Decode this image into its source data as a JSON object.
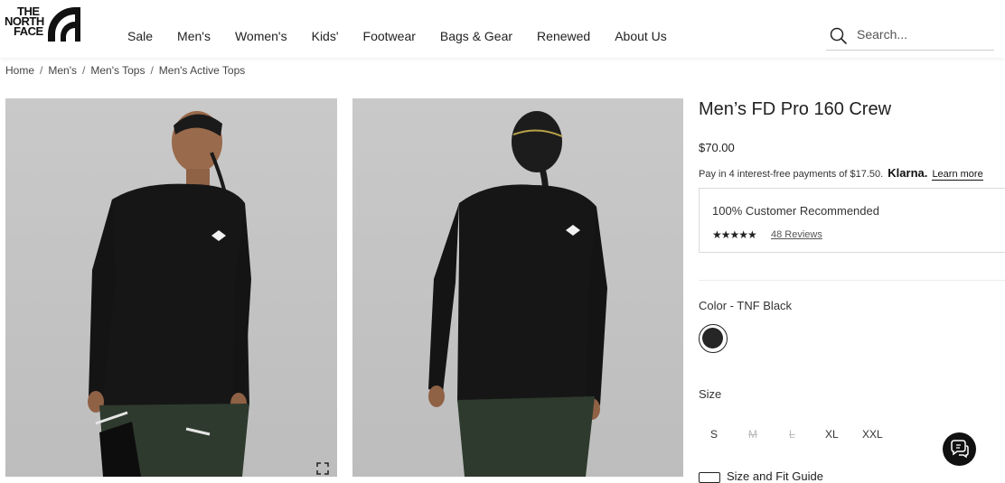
{
  "brand": {
    "logo_line1": "THE",
    "logo_line2": "NORTH",
    "logo_line3": "FACE"
  },
  "nav": {
    "items": [
      {
        "label": "Sale"
      },
      {
        "label": "Men's"
      },
      {
        "label": "Women's"
      },
      {
        "label": "Kids'"
      },
      {
        "label": "Footwear"
      },
      {
        "label": "Bags & Gear"
      },
      {
        "label": "Renewed"
      },
      {
        "label": "About Us"
      }
    ]
  },
  "search": {
    "placeholder": "Search..."
  },
  "breadcrumb": [
    {
      "label": "Home"
    },
    {
      "label": "Men's"
    },
    {
      "label": "Men's Tops"
    },
    {
      "label": "Men's Active Tops"
    }
  ],
  "product": {
    "title": "Men’s FD Pro 160 Crew",
    "price": "$70.00",
    "klarna": {
      "text": "Pay in 4 interest-free payments of $17.50.",
      "brand": "Klarna.",
      "link": "Learn more"
    },
    "recommendation": {
      "text": "100% Customer Recommended",
      "stars": "★★★★★",
      "reviews": "48 Reviews"
    },
    "color_label": "Color - TNF Black",
    "color_value": "#262626",
    "size_label": "Size",
    "sizes": [
      {
        "label": "S",
        "available": true
      },
      {
        "label": "M",
        "available": false
      },
      {
        "label": "L",
        "available": false
      },
      {
        "label": "XL",
        "available": true
      },
      {
        "label": "XXL",
        "available": true
      }
    ],
    "fit_guide": "Size and Fit Guide"
  },
  "colors": {
    "background": "#ffffff",
    "text": "#222222",
    "image_bg": "#c4c4c4"
  },
  "icons": {
    "search": "search-icon",
    "chat": "chat-icon",
    "expand": "expand-icon"
  }
}
